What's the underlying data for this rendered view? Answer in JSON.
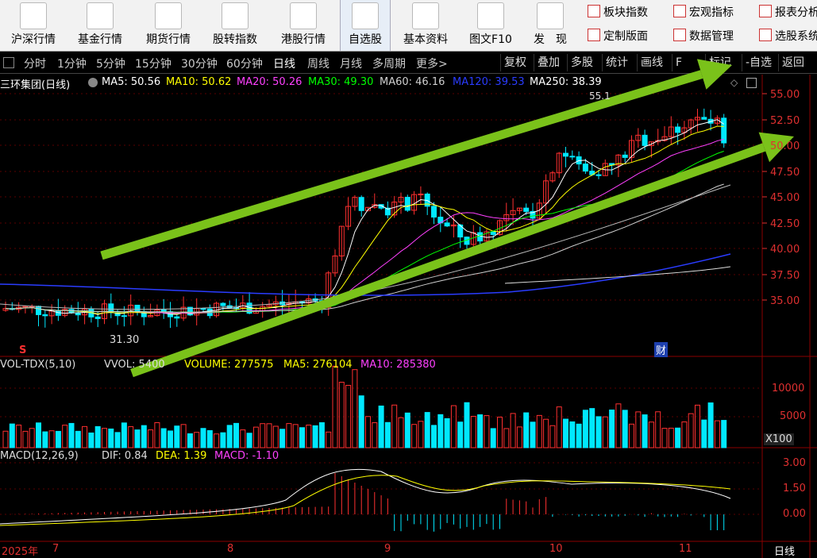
{
  "toolbar": {
    "buttons": [
      {
        "label": "沪深行情",
        "icon": "chart-line-icon"
      },
      {
        "label": "基金行情",
        "icon": "bar-chart-icon"
      },
      {
        "label": "期货行情",
        "icon": "bar-chart-icon"
      },
      {
        "label": "股转指数",
        "icon": "candlestick-icon"
      },
      {
        "label": "港股行情",
        "icon": "building-chart-icon"
      },
      {
        "label": "自选股",
        "icon": "magnifier-chart-icon"
      },
      {
        "label": "基本资料",
        "icon": "key-icon"
      },
      {
        "label": "图文F10",
        "icon": "document-icon"
      },
      {
        "label": "发　现",
        "icon": "chart-line-icon"
      }
    ],
    "small_buttons": [
      {
        "label": "板块指数"
      },
      {
        "label": "宏观指标"
      },
      {
        "label": "报表分析"
      },
      {
        "label": "定制版面"
      },
      {
        "label": "数据管理"
      },
      {
        "label": "选股系统"
      }
    ]
  },
  "period_bar": {
    "periods": [
      "分时",
      "1分钟",
      "5分钟",
      "15分钟",
      "30分钟",
      "60分钟",
      "日线",
      "周线",
      "月线",
      "多周期",
      "更多>"
    ],
    "selected": "日线",
    "right_buttons": [
      "复权",
      "叠加",
      "多股",
      "统计",
      "画线",
      "F",
      "标记",
      "-自选",
      "返回"
    ]
  },
  "price_info": {
    "title": "三环集团(日线)",
    "ma": [
      {
        "label": "MA5: 50.56",
        "color": "#ffffff"
      },
      {
        "label": "MA10: 50.62",
        "color": "#ffff00"
      },
      {
        "label": "MA20: 50.26",
        "color": "#ff40ff"
      },
      {
        "label": "MA30: 49.30",
        "color": "#00ff00"
      },
      {
        "label": "MA60: 46.16",
        "color": "#d0d0d0"
      },
      {
        "label": "MA120: 39.53",
        "color": "#2a3cff"
      },
      {
        "label": "MA250: 38.39",
        "color": "#ffffff"
      }
    ],
    "high_label": "55.1",
    "low_label": "31.30",
    "marker_s": "S",
    "marker_cai": "财"
  },
  "price_axis": [
    "55.00",
    "52.50",
    "50.00",
    "47.50",
    "45.00",
    "42.50",
    "40.00",
    "37.50",
    "35.00"
  ],
  "vol_info": {
    "title": "VOL-TDX(5,10)",
    "vvol": "VVOL: 5400",
    "volume": "VOLUME: 277575",
    "ma5": "MA5: 276104",
    "ma10": "MA10: 285380"
  },
  "vol_axis": [
    "10000",
    "5000"
  ],
  "vol_unit": "X100",
  "macd_info": {
    "title": "MACD(12,26,9)",
    "dif": "DIF: 0.84",
    "dea": "DEA: 1.39",
    "macd": "MACD: -1.10"
  },
  "macd_axis": [
    "3.00",
    "1.50",
    "0.00"
  ],
  "date_axis": {
    "labels": [
      "2025年",
      "7",
      "8",
      "9",
      "10",
      "11"
    ],
    "period_label": "日线"
  },
  "colors": {
    "up": "#ff3030",
    "down": "#00e8ff",
    "arrow": "#7ac21a",
    "grid": "#8b0000"
  }
}
